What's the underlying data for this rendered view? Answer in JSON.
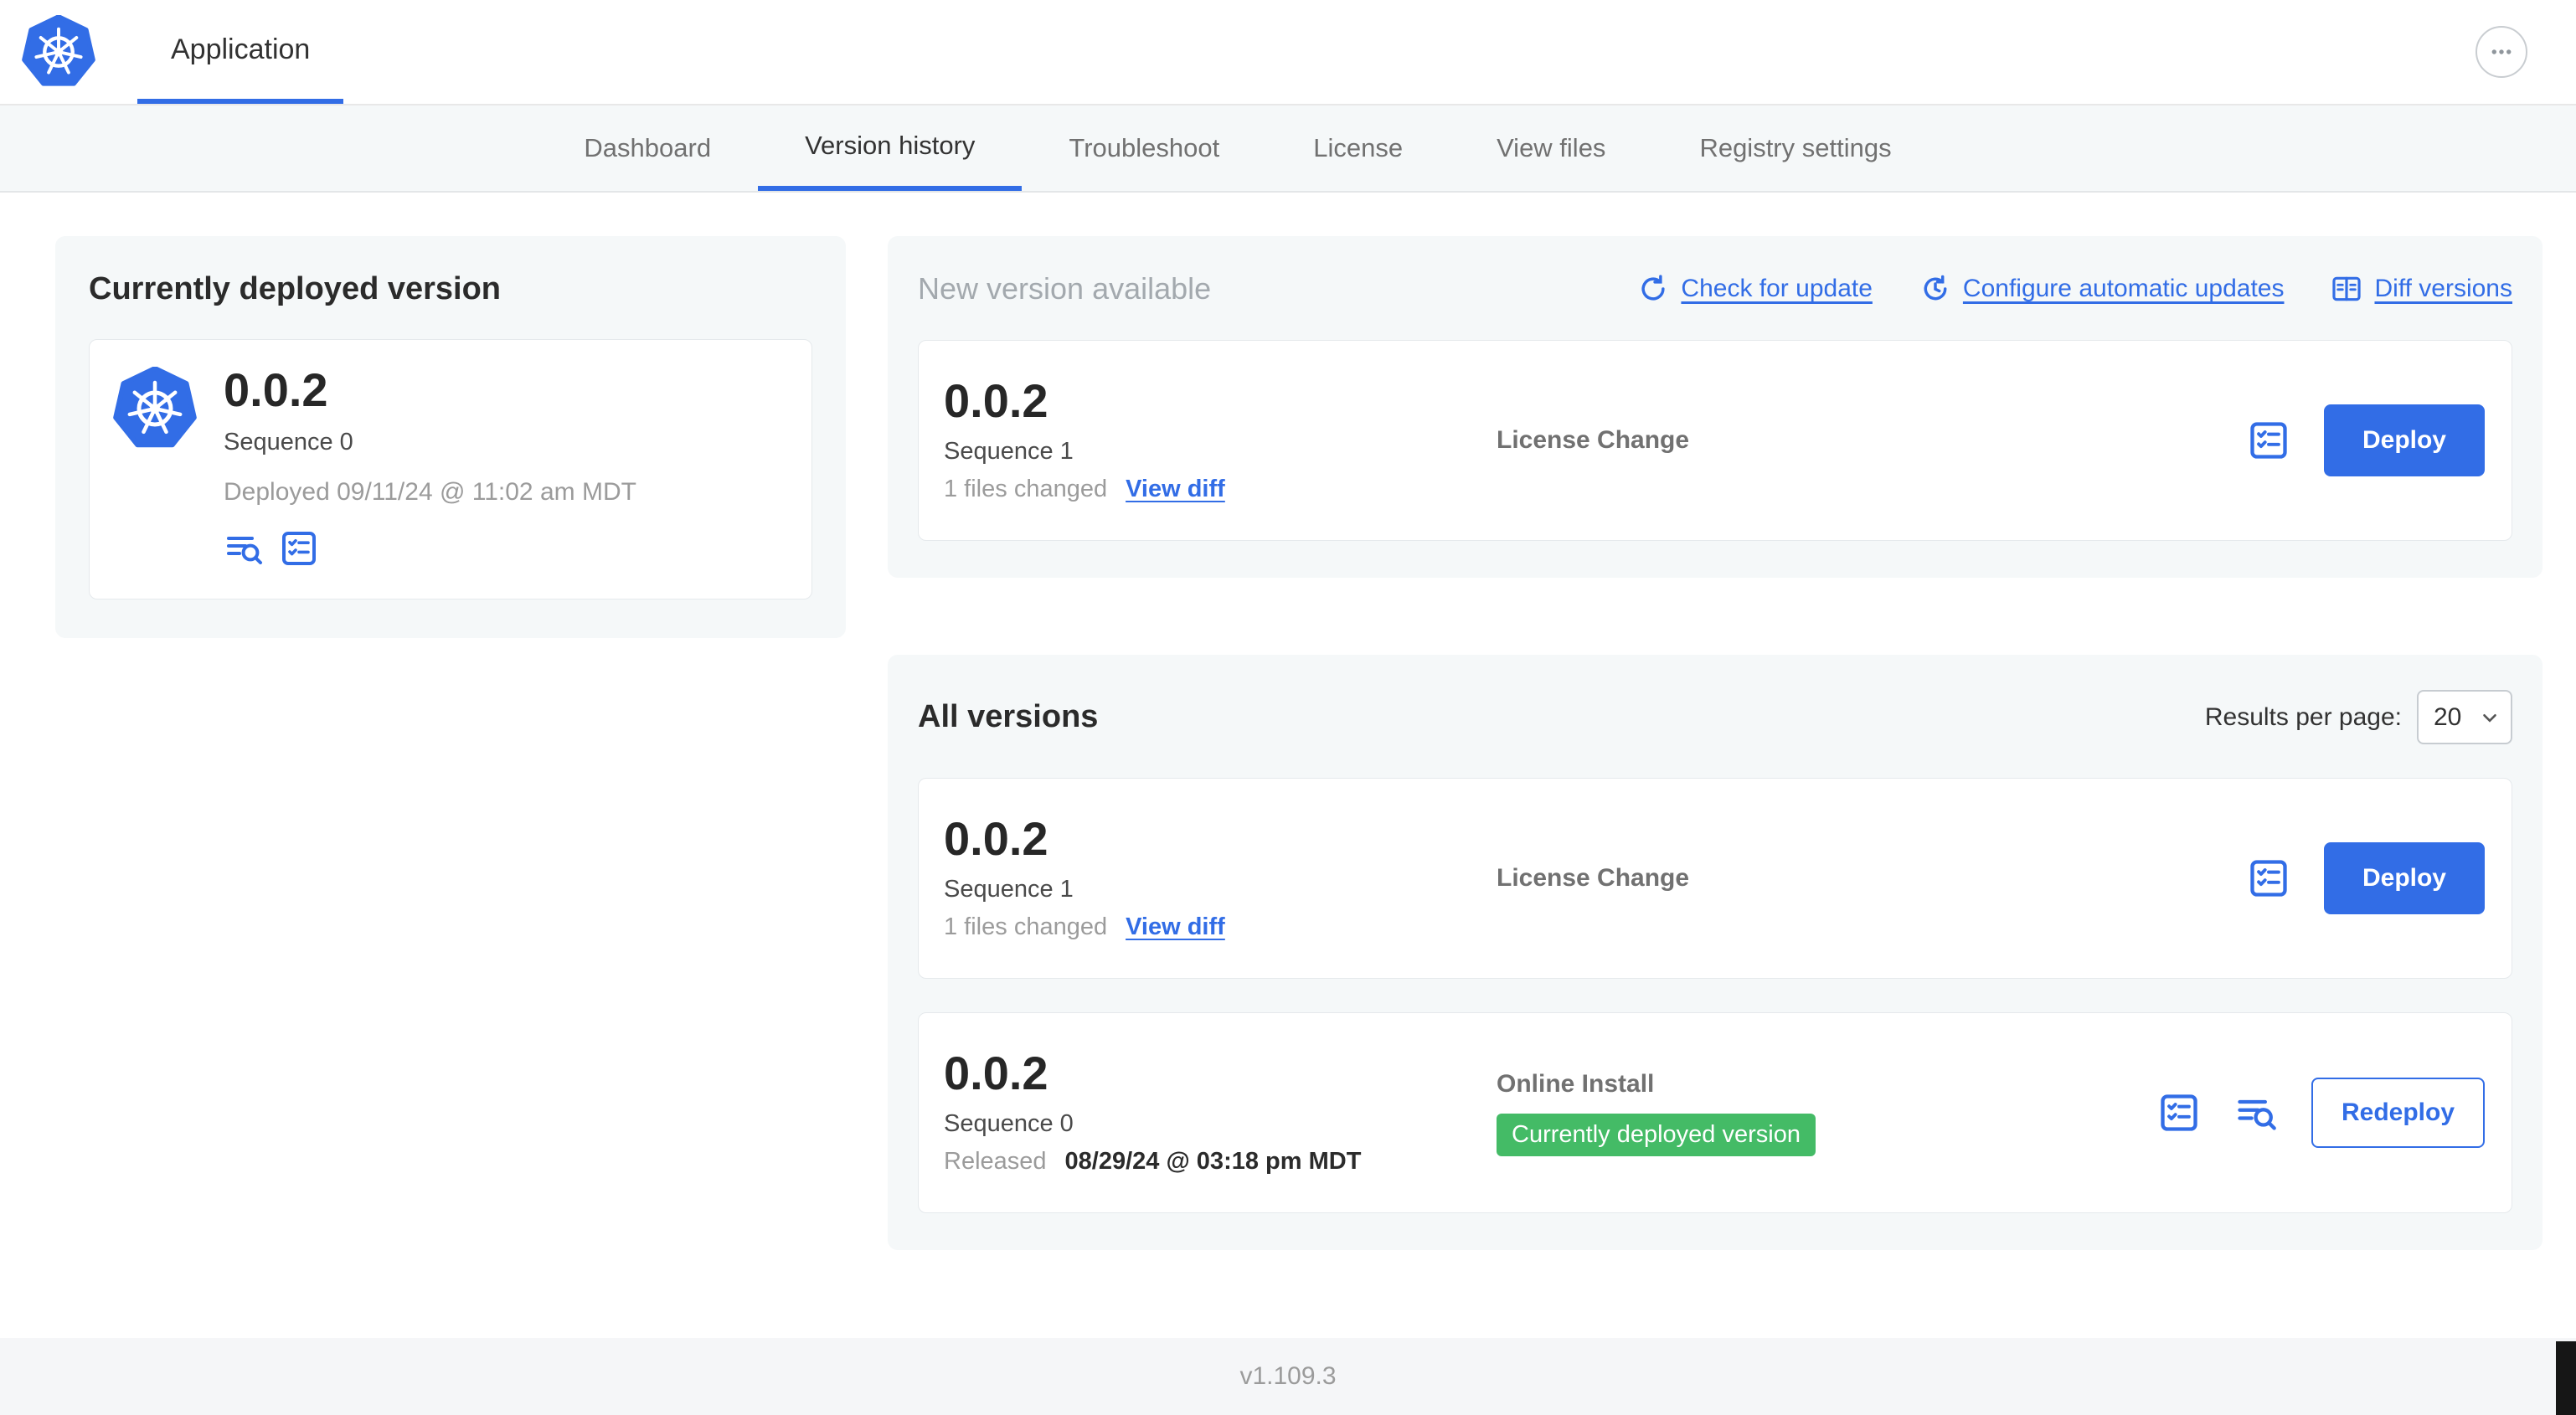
{
  "colors": {
    "accent": "#326de6",
    "badge_green": "#44bb66"
  },
  "header": {
    "app_tab_label": "Application"
  },
  "subnav": {
    "tabs": [
      "Dashboard",
      "Version history",
      "Troubleshoot",
      "License",
      "View files",
      "Registry settings"
    ],
    "active_tab": "Version history"
  },
  "deployed_card": {
    "title": "Currently deployed version",
    "version": "0.0.2",
    "sequence": "Sequence 0",
    "deployed_at": "Deployed 09/11/24 @ 11:02 am MDT"
  },
  "new_version_card": {
    "title": "New version available",
    "check_for_update": "Check for update",
    "configure_updates": "Configure automatic updates",
    "diff_versions": "Diff versions",
    "row": {
      "version": "0.0.2",
      "sequence": "Sequence 1",
      "files_changed": "1 files changed",
      "view_diff": "View diff",
      "source": "License Change",
      "deploy": "Deploy"
    }
  },
  "all_versions_card": {
    "title": "All versions",
    "results_per_page_label": "Results per page:",
    "results_per_page": "20",
    "rows": [
      {
        "version": "0.0.2",
        "sequence": "Sequence 1",
        "files_changed": "1 files changed",
        "view_diff": "View diff",
        "source": "License Change",
        "action": "Deploy"
      },
      {
        "version": "0.0.2",
        "sequence": "Sequence 0",
        "released_label": "Released",
        "released_date": "08/29/24 @ 03:18 pm MDT",
        "source": "Online Install",
        "badge": "Currently deployed version",
        "action": "Redeploy"
      }
    ]
  },
  "footer": {
    "app_version": "v1.109.3"
  }
}
